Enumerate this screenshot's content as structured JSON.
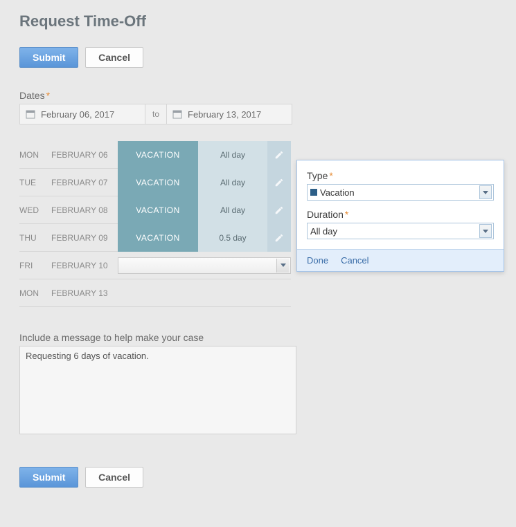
{
  "title": "Request Time-Off",
  "buttons": {
    "submit": "Submit",
    "cancel": "Cancel"
  },
  "dates": {
    "label": "Dates",
    "from": "February 06, 2017",
    "to_label": "to",
    "to": "February 13, 2017"
  },
  "days": [
    {
      "dow": "MON",
      "date": "FEBRUARY 06",
      "type": "VACATION",
      "duration": "All day",
      "editable": true
    },
    {
      "dow": "TUE",
      "date": "FEBRUARY 07",
      "type": "VACATION",
      "duration": "All day",
      "editable": true
    },
    {
      "dow": "WED",
      "date": "FEBRUARY 08",
      "type": "VACATION",
      "duration": "All day",
      "editable": true
    },
    {
      "dow": "THU",
      "date": "FEBRUARY 09",
      "type": "VACATION",
      "duration": "0.5 day",
      "editable": true
    },
    {
      "dow": "FRI",
      "date": "FEBRUARY 10",
      "blank": true,
      "select": true
    },
    {
      "dow": "MON",
      "date": "FEBRUARY 13",
      "blank": true
    }
  ],
  "message": {
    "label": "Include a message to help make your case",
    "value": "Requesting 6 days of vacation."
  },
  "popover": {
    "type_label": "Type",
    "type_value": "Vacation",
    "duration_label": "Duration",
    "duration_value": "All day",
    "done": "Done",
    "cancel": "Cancel"
  }
}
